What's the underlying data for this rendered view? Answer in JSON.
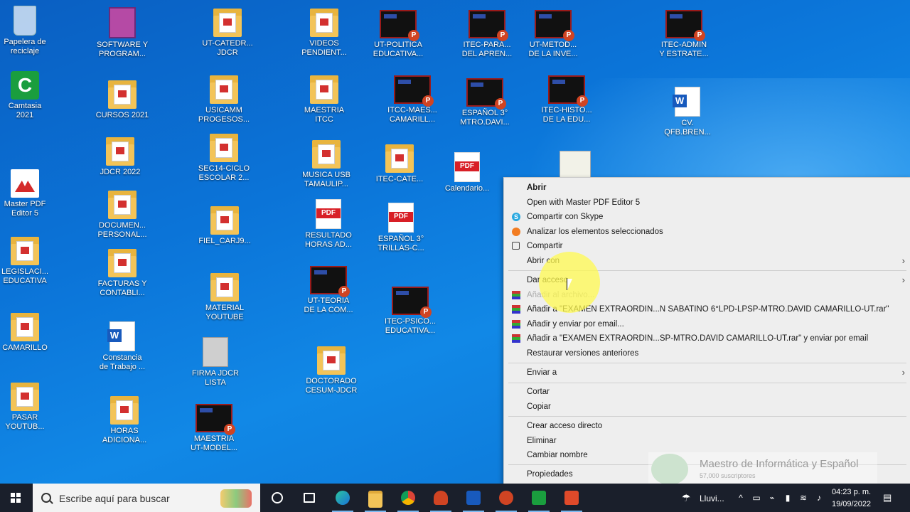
{
  "desktop": {
    "icons": [
      {
        "label": "Papelera de\nreciclaje",
        "kind": "recycle-bin"
      },
      {
        "label": "Camtasia\n2021",
        "kind": "camtasia"
      },
      {
        "label": "Master PDF\nEditor 5",
        "kind": "master-pdf"
      },
      {
        "label": "LEGISLACI...\nEDUCATIVA",
        "kind": "folder"
      },
      {
        "label": "CAMARILLO",
        "kind": "folder"
      },
      {
        "label": "PASAR\nYOUTUB...",
        "kind": "folder"
      },
      {
        "label": "SOFTWARE Y\nPROGRAM...",
        "kind": "archive"
      },
      {
        "label": "CURSOS 2021",
        "kind": "folder"
      },
      {
        "label": "JDCR 2022",
        "kind": "folder"
      },
      {
        "label": "DOCUMEN...\nPERSONAL...",
        "kind": "folder"
      },
      {
        "label": "FACTURAS Y\nCONTABLI...",
        "kind": "folder"
      },
      {
        "label": "Constancia\nde Trabajo ...",
        "kind": "word"
      },
      {
        "label": "HORAS\nADICIONA...",
        "kind": "folder"
      },
      {
        "label": "UT-CATEDR...\nJDCR",
        "kind": "folder"
      },
      {
        "label": "USICAMM\nPROGESOS...",
        "kind": "folder"
      },
      {
        "label": "SEC14-CICLO\nESCOLAR 2...",
        "kind": "folder"
      },
      {
        "label": "FIEL_CARJ9...",
        "kind": "folder"
      },
      {
        "label": "MATERIAL\nYOUTUBE",
        "kind": "folder"
      },
      {
        "label": "FIRMA JDCR\nLISTA",
        "kind": "signature"
      },
      {
        "label": "MAESTRIA\nUT-MODEL...",
        "kind": "ppt"
      },
      {
        "label": "VIDEOS\nPENDIENT...",
        "kind": "folder"
      },
      {
        "label": "MAESTRIA\nITCC",
        "kind": "folder"
      },
      {
        "label": "MUSICA USB\nTAMAULIP...",
        "kind": "folder"
      },
      {
        "label": "RESULTADO\nHORAS AD...",
        "kind": "pdf"
      },
      {
        "label": "UT-TEORIA\nDE LA COM...",
        "kind": "ppt"
      },
      {
        "label": "DOCTORADO\nCESUM-JDCR",
        "kind": "folder"
      },
      {
        "label": "UT-POLITICA\nEDUCATIVA...",
        "kind": "ppt"
      },
      {
        "label": "ITCC-MAES...\nCAMARILL...",
        "kind": "ppt"
      },
      {
        "label": "ITEC-CATE...",
        "kind": "folder"
      },
      {
        "label": "ESPAÑOL 3°\nTRILLAS-C...",
        "kind": "pdf"
      },
      {
        "label": "ITEC-PSICO...\nEDUCATIVA...",
        "kind": "ppt"
      },
      {
        "label": "Calendario...",
        "kind": "pdf"
      },
      {
        "label": "ITEC-PARA...\nDEL APREN...",
        "kind": "ppt"
      },
      {
        "label": "ESPAÑOL 3°\nMTRO.DAVI...",
        "kind": "ppt"
      },
      {
        "label": "UT-METOD...\nDE LA INVE...",
        "kind": "ppt"
      },
      {
        "label": "ITEC-HISTO...\nDE LA EDU...",
        "kind": "ppt"
      },
      {
        "label": "",
        "kind": "thumbnail"
      },
      {
        "label": "ITEC-ADMIN\nY ESTRATE...",
        "kind": "ppt"
      },
      {
        "label": "CV.\nQFB.BREN...",
        "kind": "word"
      }
    ]
  },
  "context_menu": {
    "items": [
      {
        "label": "Abrir",
        "bold": true,
        "icon": ""
      },
      {
        "label": "Open with Master PDF Editor 5",
        "icon": ""
      },
      {
        "label": "Compartir con Skype",
        "icon": "skype-icon"
      },
      {
        "label": "Analizar los elementos seleccionados",
        "icon": "avast-icon"
      },
      {
        "label": "Compartir",
        "icon": "share-icon"
      },
      {
        "label": "Abrir con",
        "icon": "",
        "submenu": true
      },
      {
        "label": "Dar acceso",
        "icon": "",
        "submenu": true
      },
      {
        "label": "Añadir al archivo...",
        "icon": "winrar-icon",
        "dim": true
      },
      {
        "label": "Añadir a \"EXAMEN EXTRAORDIN...N SABATINO 6°LPD-LPSP-MTRO.DAVID CAMARILLO-UT.rar\"",
        "icon": "winrar-icon"
      },
      {
        "label": "Añadir y enviar por email...",
        "icon": "winrar-icon"
      },
      {
        "label": "Añadir a \"EXAMEN EXTRAORDIN...SP-MTRO.DAVID CAMARILLO-UT.rar\" y enviar por email",
        "icon": "winrar-icon"
      },
      {
        "label": "Restaurar versiones anteriores",
        "icon": ""
      },
      {
        "label": "Enviar a",
        "icon": "",
        "submenu": true
      },
      {
        "label": "Cortar",
        "icon": ""
      },
      {
        "label": "Copiar",
        "icon": ""
      },
      {
        "label": "Crear acceso directo",
        "icon": ""
      },
      {
        "label": "Eliminar",
        "icon": ""
      },
      {
        "label": "Cambiar nombre",
        "icon": ""
      },
      {
        "label": "Propiedades",
        "icon": ""
      }
    ]
  },
  "watermark": {
    "title": "Maestro de Informática y Español",
    "subtitle": "57,000 suscriptores"
  },
  "taskbar": {
    "search_placeholder": "Escribe aquí para buscar",
    "apps": [
      "cortana-icon",
      "task-view-icon",
      "edge-icon",
      "file-explorer-icon",
      "chrome-icon",
      "onenote-icon",
      "word-icon",
      "powerpoint-icon",
      "camtasia-icon",
      "camtasia-recorder-icon"
    ],
    "weather": "Lluvi...",
    "time": "04:23 p. m.",
    "date": "19/09/2022"
  }
}
